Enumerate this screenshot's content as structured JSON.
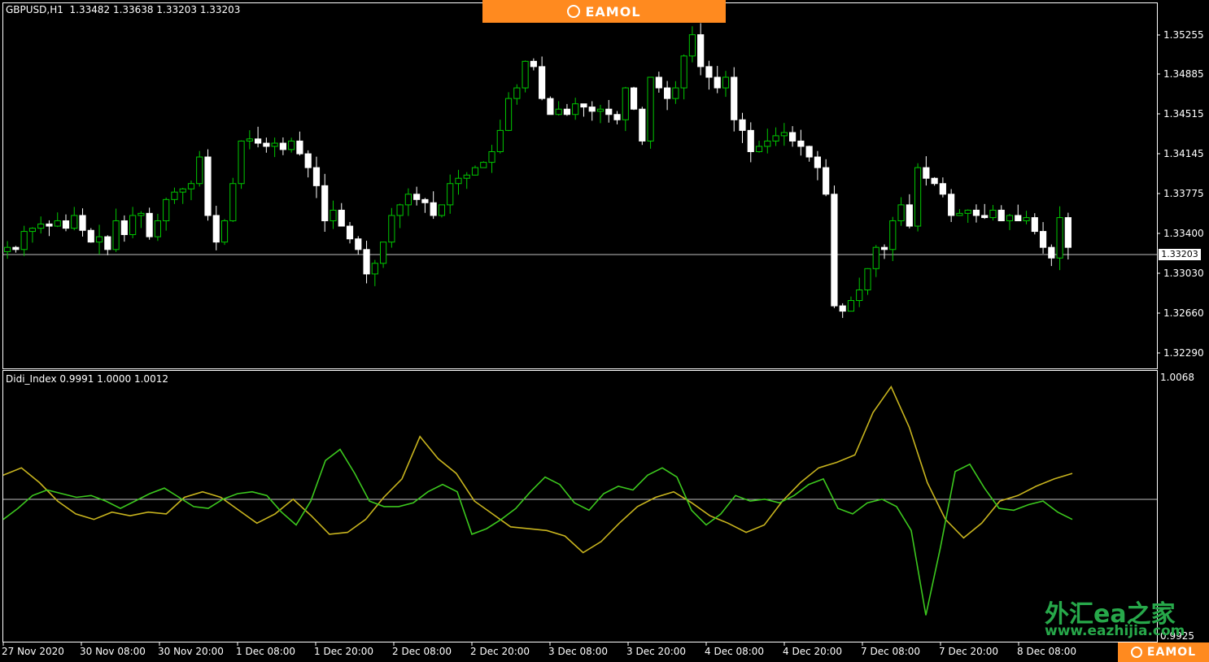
{
  "header": {
    "symbol_info": "GBPUSD,H1  1.33482 1.33638 1.33203 1.33203"
  },
  "brand_banner": {
    "text": "EAMOL",
    "bg_color": "#ff8a1f"
  },
  "price_axis": {
    "labels": [
      "1.35255",
      "1.34885",
      "1.34515",
      "1.34145",
      "1.33775",
      "1.33400",
      "1.33030",
      "1.32660",
      "1.32290"
    ],
    "current_price": "1.33203"
  },
  "indicator": {
    "info": "Didi_Index 0.9991 1.0000 1.0012",
    "axis_top": "1.0068",
    "axis_bottom": "0.9925",
    "fast_color": "#3cc81e",
    "slow_color": "#c8b41e"
  },
  "time_axis": {
    "labels": [
      "27 Nov 2020",
      "30 Nov 08:00",
      "30 Nov 20:00",
      "1 Dec 08:00",
      "1 Dec 20:00",
      "2 Dec 08:00",
      "2 Dec 20:00",
      "3 Dec 08:00",
      "3 Dec 20:00",
      "4 Dec 08:00",
      "4 Dec 20:00",
      "7 Dec 08:00",
      "7 Dec 20:00",
      "8 Dec 08:00"
    ]
  },
  "watermark": {
    "line1": "外汇ea之家",
    "line2": "www.eazhijia.com"
  },
  "corner_brand": {
    "text": "EAMOL"
  },
  "chart_data": {
    "type": "candlestick",
    "symbol": "GBPUSD",
    "timeframe": "H1",
    "price_ylim": [
      1.321,
      1.3545
    ],
    "bull_color": "#00c800",
    "bear_color": "#ffffff",
    "close_path": [
      1.332,
      1.3318,
      1.3335,
      1.3338,
      1.3342,
      1.334,
      1.3345,
      1.3338,
      1.335,
      1.3336,
      1.3325,
      1.333,
      1.3318,
      1.3345,
      1.3332,
      1.335,
      1.3352,
      1.333,
      1.3345,
      1.3365,
      1.3372,
      1.3375,
      1.338,
      1.3405,
      1.335,
      1.3325,
      1.3345,
      1.338,
      1.342,
      1.3422,
      1.3418,
      1.3415,
      1.3418,
      1.3412,
      1.342,
      1.3408,
      1.3395,
      1.3378,
      1.3345,
      1.3355,
      1.334,
      1.3328,
      1.3318,
      1.3295,
      1.3305,
      1.3325,
      1.335,
      1.336,
      1.337,
      1.3365,
      1.3362,
      1.335,
      1.336,
      1.338,
      1.3385,
      1.3388,
      1.3395,
      1.34,
      1.341,
      1.343,
      1.346,
      1.347,
      1.3495,
      1.349,
      1.346,
      1.3445,
      1.345,
      1.3445,
      1.3455,
      1.3452,
      1.3448,
      1.345,
      1.3445,
      1.344,
      1.347,
      1.345,
      1.342,
      1.348,
      1.347,
      1.346,
      1.347,
      1.35,
      1.352,
      1.349,
      1.348,
      1.347,
      1.348,
      1.344,
      1.343,
      1.341,
      1.3415,
      1.342,
      1.3425,
      1.3428,
      1.342,
      1.3415,
      1.3405,
      1.3395,
      1.337,
      1.3265,
      1.326,
      1.327,
      1.328,
      1.33,
      1.332,
      1.3318,
      1.3345,
      1.336,
      1.334,
      1.3395,
      1.3385,
      1.338,
      1.337,
      1.335,
      1.3352,
      1.3355,
      1.335,
      1.3348,
      1.3355,
      1.3345,
      1.335,
      1.3345,
      1.3348,
      1.3335,
      1.332,
      1.331,
      1.3348,
      1.332
    ]
  },
  "indicator_data": {
    "type": "line",
    "series_count": 2,
    "ylim": [
      0.9925,
      1.0068
    ],
    "level": 1.0,
    "fast": [
      0.999,
      0.9996,
      1.0003,
      1.0006,
      1.0004,
      1.0002,
      1.0003,
      1.0,
      0.9996,
      1.0,
      1.0004,
      1.0007,
      1.0002,
      0.9997,
      0.9996,
      1.0001,
      1.0004,
      1.0005,
      1.0003,
      0.9994,
      0.9987,
      1.0,
      1.0022,
      1.0028,
      1.0015,
      1.0,
      0.9997,
      0.9997,
      0.9999,
      1.0005,
      1.0009,
      1.0005,
      0.9982,
      0.9985,
      0.999,
      0.9996,
      1.0005,
      1.0013,
      1.0009,
      0.9999,
      0.9995,
      1.0004,
      1.0008,
      1.0006,
      1.0014,
      1.0018,
      1.0013,
      0.9995,
      0.9987,
      0.9993,
      1.0003,
      1.0,
      1.0001,
      0.9999,
      1.0003,
      1.0009,
      1.0012,
      0.9996,
      0.9993,
      0.9999,
      1.0001,
      0.9997,
      0.9984,
      0.9938,
      0.9975,
      1.0016,
      1.002,
      1.0007,
      0.9996,
      0.9995,
      0.9998,
      1.0,
      0.9994,
      0.999
    ]
  },
  "indicator_slow": {
    "values": [
      1.0014,
      1.0018,
      1.001,
      1.0,
      0.9993,
      0.999,
      0.9994,
      0.9992,
      0.9994,
      0.9993,
      1.0002,
      1.0005,
      1.0002,
      0.9995,
      0.9988,
      0.9993,
      1.0001,
      0.9992,
      0.9982,
      0.9983,
      0.999,
      1.0002,
      1.0012,
      1.0035,
      1.0023,
      1.0015,
      1.0,
      0.9993,
      0.9986,
      0.9985,
      0.9984,
      0.9981,
      0.9972,
      0.9978,
      0.9988,
      0.9997,
      1.0002,
      1.0005,
      0.9999,
      0.9992,
      0.9988,
      0.9983,
      0.9987,
      1.0,
      1.001,
      1.0018,
      1.0021,
      1.0025,
      1.0048,
      1.0062,
      1.004,
      1.001,
      0.999,
      0.998,
      0.9988,
      1.0,
      1.0003,
      1.0008,
      1.0012,
      1.0015
    ]
  }
}
